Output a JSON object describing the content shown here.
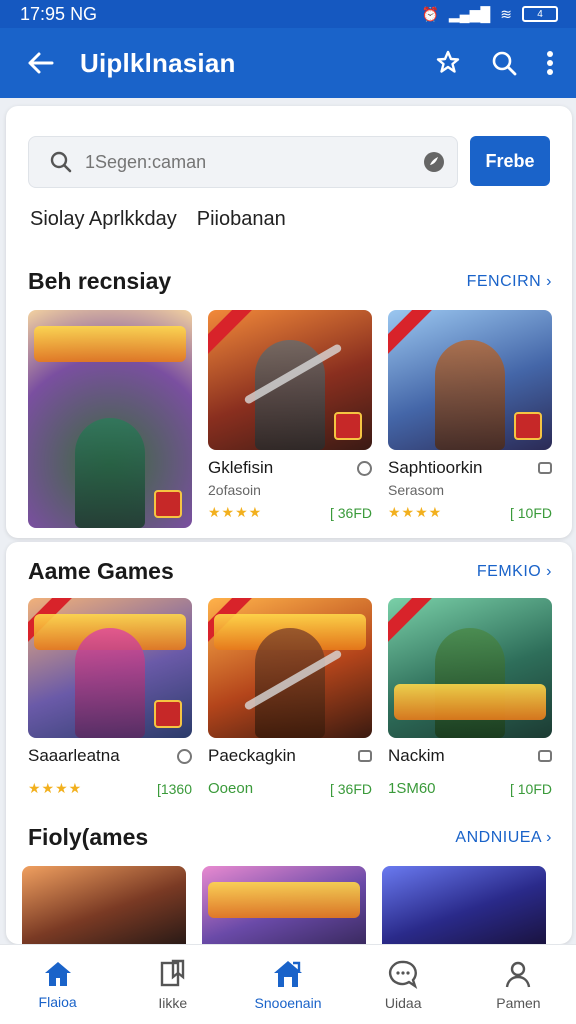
{
  "status": {
    "time": "17:95",
    "carrier": "NG",
    "battery": "4"
  },
  "app_bar": {
    "title": "Uiplklnasian"
  },
  "search": {
    "placeholder": "1Segen:caman",
    "button": "Frebe"
  },
  "filters": [
    "Siolay Aprlkkday",
    "Piiobanan"
  ],
  "sections": [
    {
      "title": "Beh recnsiay",
      "link": "FENCIRN",
      "items": [
        {
          "title": "",
          "subtitle": "",
          "rating": "",
          "price": ""
        },
        {
          "title": "Gklefisin",
          "subtitle": "2ofasoin",
          "rating": "★★★★",
          "price": "[ 36FD"
        },
        {
          "title": "Saphtioorkin",
          "subtitle": "Serasom",
          "rating": "★★★★",
          "price": "[ 10FD"
        }
      ]
    },
    {
      "title": "Aame Games",
      "link": "FEMKIO",
      "items": [
        {
          "title": "Saaarleatna",
          "rating": "★★★★",
          "price": "[1360"
        },
        {
          "title": "Paeckagkin",
          "subtitle_green": "Ooeon",
          "price": "[ 36FD"
        },
        {
          "title": "Nackim",
          "subtitle_green": "1SM60",
          "price": "[ 10FD"
        }
      ]
    },
    {
      "title": "Fioly(ames",
      "link": "ANDNIUEA"
    }
  ],
  "bottom_nav": [
    {
      "label": "Flaioa",
      "icon": "home-icon",
      "active": false
    },
    {
      "label": "Iikke",
      "icon": "bookmark-icon",
      "active": false
    },
    {
      "label": "Snooenain",
      "icon": "store-icon",
      "active": true
    },
    {
      "label": "Uidaa",
      "icon": "chat-icon",
      "active": false
    },
    {
      "label": "Pamen",
      "icon": "profile-icon",
      "active": false
    }
  ],
  "colors": {
    "primary": "#1A63C9",
    "accent_green": "#3a9a3a",
    "star": "#f2b01e"
  }
}
